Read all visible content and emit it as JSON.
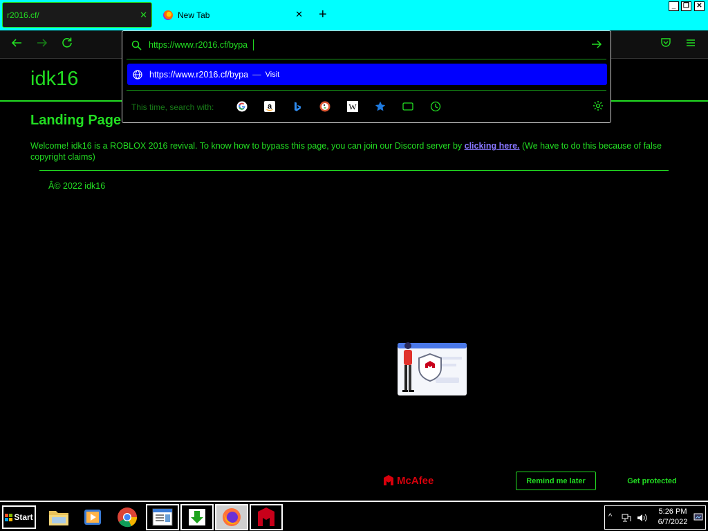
{
  "browser": {
    "tabs": [
      {
        "label": "r2016.cf/",
        "active": true
      },
      {
        "label": "New Tab",
        "active": false
      }
    ],
    "window_controls": [
      "minimize",
      "restore",
      "close"
    ]
  },
  "urlbar": {
    "value": "https://www.r2016.cf/bypa",
    "suggestion": {
      "url": "https://www.r2016.cf/bypa",
      "separator": "—",
      "action": "Visit"
    },
    "search_with_label": "This time, search with:",
    "engines": [
      "google-icon",
      "amazon-icon",
      "bing-icon",
      "duckduckgo-icon",
      "wikipedia-icon",
      "bookmarks-icon",
      "tabs-icon",
      "history-icon"
    ]
  },
  "page": {
    "site_title": "idk16",
    "heading": "Landing Page",
    "welcome_before": "Welcome! idk16 is a ROBLOX 2016 revival. To know how to bypass this page, you can join our Discord server by ",
    "welcome_link": "clicking here.",
    "welcome_after": " (We have to do this because of false copyright claims)",
    "copyright": "Â© 2022 idk16"
  },
  "mcafee": {
    "brand": "McAfee",
    "remind_label": "Remind me later",
    "protect_label": "Get protected"
  },
  "taskbar": {
    "start_label": "Start",
    "clock_time": "5:26 PM",
    "clock_date": "6/7/2022"
  },
  "colors": {
    "accent": "#22dd22",
    "tabstrip": "#00ffff",
    "suggestion_highlight": "#0000ff",
    "link": "#8877ff",
    "mcafee_red": "#d8000c"
  }
}
